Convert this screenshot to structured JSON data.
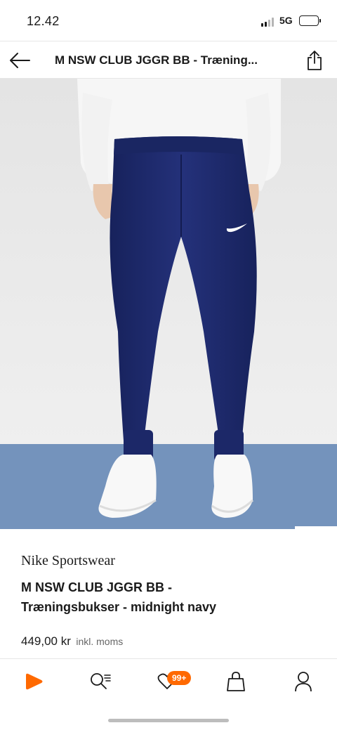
{
  "status_bar": {
    "time": "12.42",
    "network": "5G",
    "icons": [
      "signal-icon",
      "battery-icon"
    ]
  },
  "header": {
    "title": "M NSW CLUB JGGR BB - Træning...",
    "icons": [
      "back-arrow-icon",
      "share-icon"
    ]
  },
  "product_image": {
    "overlay_icons": [
      "heart-icon",
      "similar-items-icon",
      "shopping-bag-icon"
    ]
  },
  "product": {
    "brand": "Nike Sportswear",
    "name_line1": "M NSW CLUB JGGR BB -",
    "name_line2": "Træningsbukser - midnight navy",
    "price": "449,00 kr",
    "vat_note": "inkl. moms"
  },
  "bottom_nav": {
    "items": [
      {
        "icon": "home-play-icon",
        "active": true
      },
      {
        "icon": "search-list-icon"
      },
      {
        "icon": "wishlist-heart-icon",
        "badge": "99+"
      },
      {
        "icon": "bag-icon"
      },
      {
        "icon": "profile-icon"
      }
    ]
  },
  "colors": {
    "accent": "#ff6900",
    "pants_navy": "#1f2b6b",
    "carpet": "#6f8fb8",
    "wall": "#ebebeb"
  }
}
